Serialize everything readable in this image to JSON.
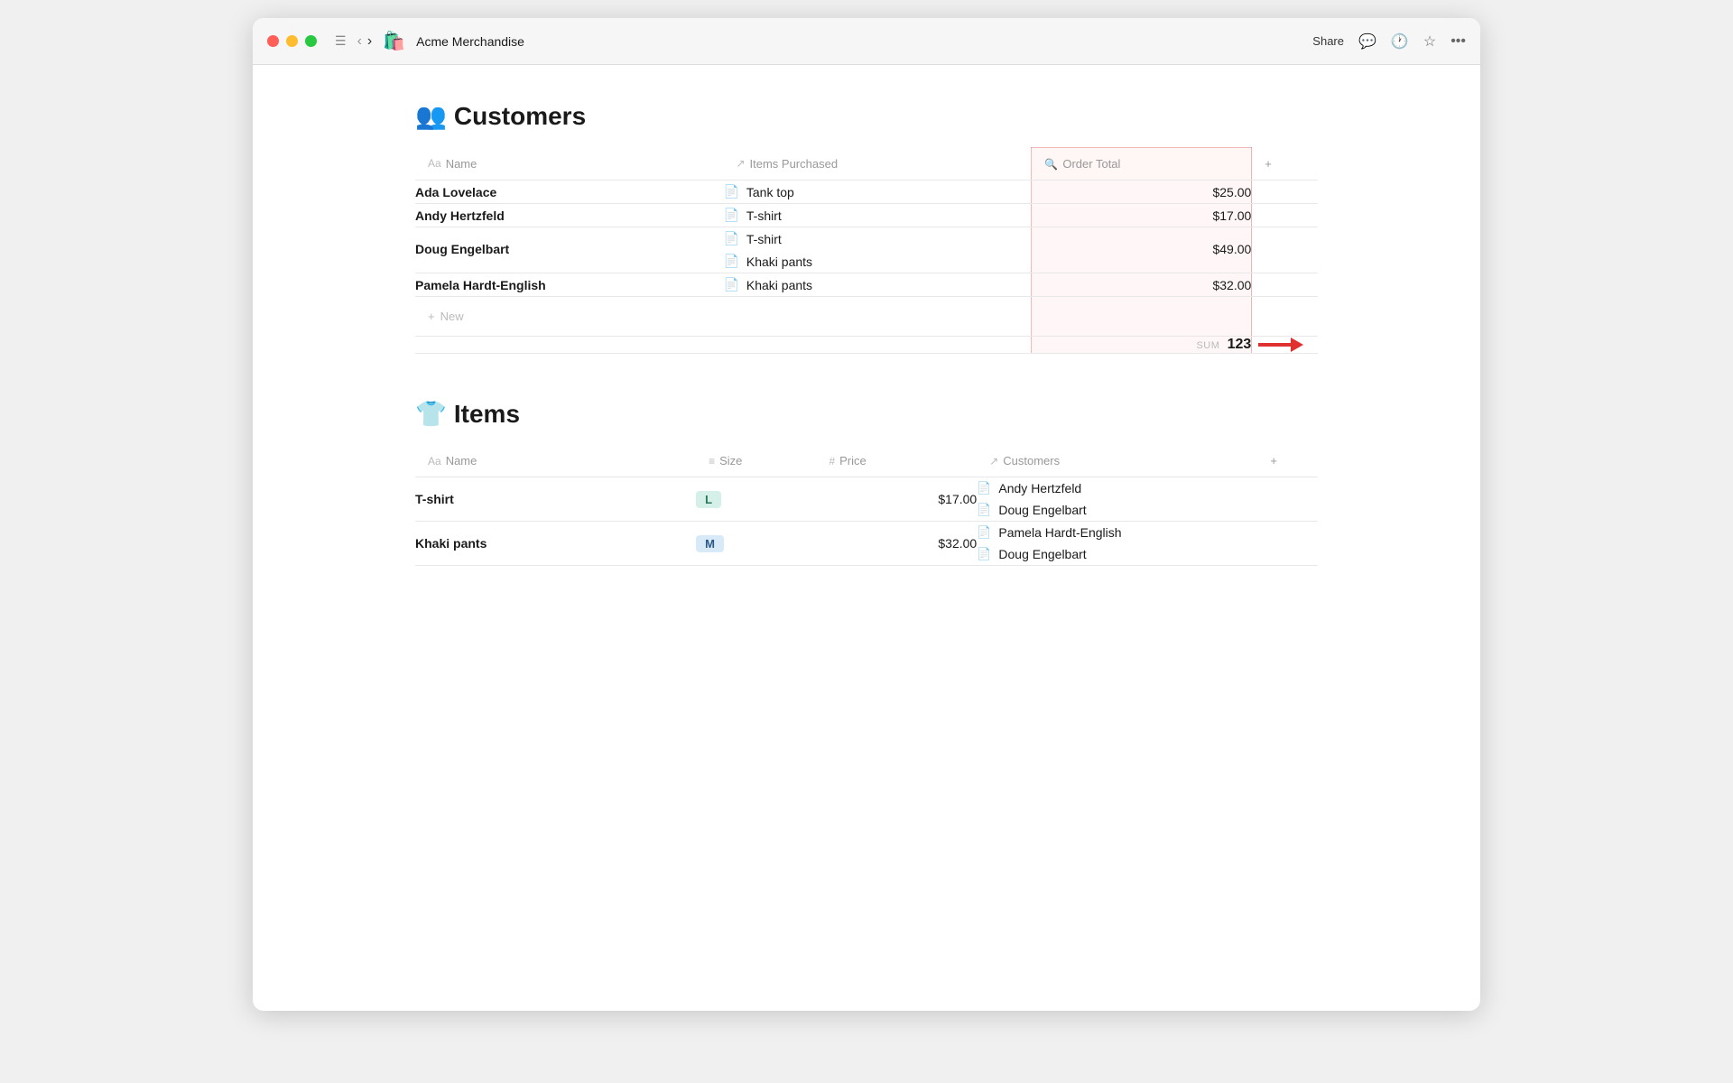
{
  "titlebar": {
    "app_icon": "🛍️",
    "app_title": "Acme Merchandise",
    "share_label": "Share",
    "icons": {
      "chat": "💬",
      "history": "🕐",
      "star": "☆",
      "more": "···"
    }
  },
  "customers_section": {
    "emoji": "👥",
    "title": "Customers",
    "columns": {
      "name": "Name",
      "items_purchased": "Items Purchased",
      "order_total": "Order Total",
      "plus": "+"
    },
    "rows": [
      {
        "name": "Ada Lovelace",
        "items": [
          "Tank top"
        ],
        "order_total": "$25.00"
      },
      {
        "name": "Andy Hertzfeld",
        "items": [
          "T-shirt"
        ],
        "order_total": "$17.00"
      },
      {
        "name": "Doug Engelbart",
        "items": [
          "T-shirt",
          "Khaki pants"
        ],
        "order_total": "$49.00"
      },
      {
        "name": "Pamela Hardt-English",
        "items": [
          "Khaki pants"
        ],
        "order_total": "$32.00"
      }
    ],
    "new_label": "New",
    "sum_label": "SUM",
    "sum_value": "123"
  },
  "items_section": {
    "emoji": "👕",
    "title": "Items",
    "columns": {
      "name": "Name",
      "size": "Size",
      "price": "Price",
      "customers": "Customers",
      "plus": "+"
    },
    "rows": [
      {
        "name": "T-shirt",
        "size": "L",
        "size_color": "green",
        "price": "$17.00",
        "customers": [
          "Andy Hertzfeld",
          "Doug Engelbart"
        ]
      },
      {
        "name": "Khaki pants",
        "size": "M",
        "size_color": "blue",
        "price": "$32.00",
        "customers": [
          "Pamela Hardt-English",
          "Doug Engelbart"
        ]
      }
    ]
  }
}
